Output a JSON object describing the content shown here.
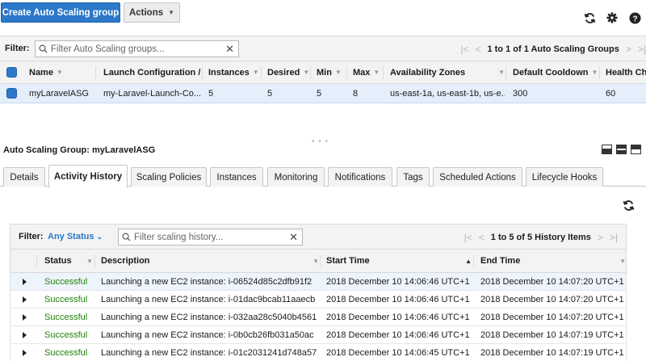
{
  "toolbar": {
    "create_label": "Create Auto Scaling group",
    "actions_label": "Actions",
    "icons": [
      "refresh-icon",
      "gear-icon",
      "help-icon"
    ]
  },
  "filter": {
    "label": "Filter:",
    "placeholder": "Filter Auto Scaling groups...",
    "pagination": "1 to 1 of 1 Auto Scaling Groups"
  },
  "asg_table": {
    "columns": [
      "Name",
      "Launch Configuration /",
      "Instances",
      "Desired",
      "Min",
      "Max",
      "Availability Zones",
      "Default Cooldown",
      "Health Ch"
    ],
    "rows": [
      {
        "name": "myLaravelASG",
        "launch_config": "my-Laravel-Launch-Co...",
        "instances": "5",
        "desired": "5",
        "min": "5",
        "max": "8",
        "zones": "us-east-1a, us-east-1b, us-e...",
        "cooldown": "300",
        "health": "60"
      }
    ]
  },
  "detail": {
    "title": "Auto Scaling Group: myLaravelASG",
    "tabs": [
      "Details",
      "Activity History",
      "Scaling Policies",
      "Instances",
      "Monitoring",
      "Notifications",
      "Tags",
      "Scheduled Actions",
      "Lifecycle Hooks"
    ],
    "active_tab": "Activity History"
  },
  "history": {
    "filter_label": "Filter:",
    "status_filter": "Any Status",
    "search_placeholder": "Filter scaling history...",
    "pagination": "1 to 5 of 5 History Items",
    "columns": [
      "Status",
      "Description",
      "Start Time",
      "End Time"
    ],
    "rows": [
      {
        "status": "Successful",
        "description": "Launching a new EC2 instance: i-06524d85c2dfb91f2",
        "start": "2018 December 10 14:06:46 UTC+1",
        "end": "2018 December 10 14:07:20 UTC+1"
      },
      {
        "status": "Successful",
        "description": "Launching a new EC2 instance: i-01dac9bcab11aaecb",
        "start": "2018 December 10 14:06:46 UTC+1",
        "end": "2018 December 10 14:07:20 UTC+1"
      },
      {
        "status": "Successful",
        "description": "Launching a new EC2 instance: i-032aa28c5040b4561",
        "start": "2018 December 10 14:06:46 UTC+1",
        "end": "2018 December 10 14:07:20 UTC+1"
      },
      {
        "status": "Successful",
        "description": "Launching a new EC2 instance: i-0b0cb26fb031a50ac",
        "start": "2018 December 10 14:06:46 UTC+1",
        "end": "2018 December 10 14:07:19 UTC+1"
      },
      {
        "status": "Successful",
        "description": "Launching a new EC2 instance: i-01c2031241d748a57",
        "start": "2018 December 10 14:06:45 UTC+1",
        "end": "2018 December 10 14:07:19 UTC+1"
      }
    ]
  },
  "colors": {
    "primary": "#2c78c9",
    "success": "#1d8102",
    "selected_row": "#e5eefb"
  }
}
